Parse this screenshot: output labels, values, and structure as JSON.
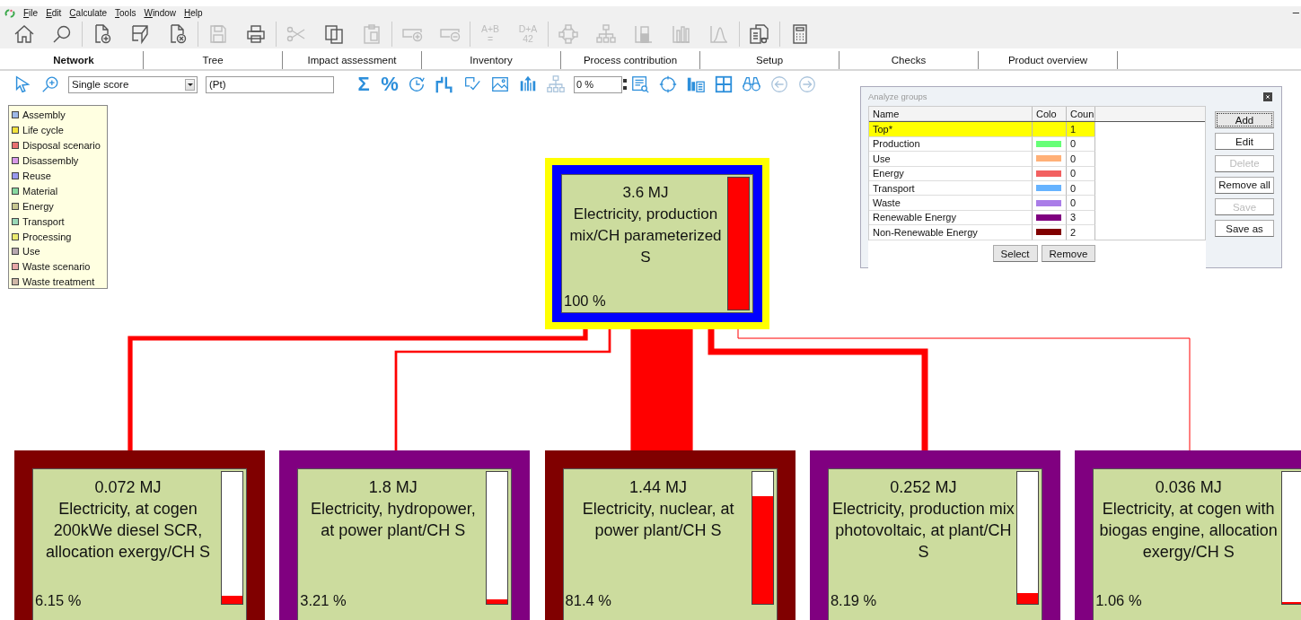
{
  "menu": {
    "items": [
      "File",
      "Edit",
      "Calculate",
      "Tools",
      "Window",
      "Help"
    ]
  },
  "minimize": "–",
  "toolbar": [
    [
      {
        "kind": "home",
        "disabled": false
      },
      {
        "kind": "search",
        "disabled": false
      }
    ],
    [
      {
        "kind": "new-doc",
        "disabled": false
      },
      {
        "kind": "open-doc",
        "disabled": false
      },
      {
        "kind": "close-doc",
        "disabled": false
      }
    ],
    [
      {
        "kind": "save",
        "disabled": true
      },
      {
        "kind": "print",
        "disabled": false
      }
    ],
    [
      {
        "kind": "cut",
        "disabled": true
      },
      {
        "kind": "copy",
        "disabled": false
      },
      {
        "kind": "paste",
        "disabled": true
      }
    ],
    [
      {
        "kind": "add-group",
        "disabled": true
      },
      {
        "kind": "remove-group",
        "disabled": true
      }
    ],
    [
      {
        "kind": "formula",
        "lines": [
          "A+B",
          "="
        ],
        "disabled": true
      },
      {
        "kind": "formula",
        "lines": [
          "D+A",
          "42"
        ],
        "disabled": true
      }
    ],
    [
      {
        "kind": "network",
        "disabled": true
      },
      {
        "kind": "tree",
        "disabled": true
      },
      {
        "kind": "bar",
        "disabled": true
      },
      {
        "kind": "bars",
        "disabled": true
      },
      {
        "kind": "curve",
        "disabled": true
      }
    ],
    [
      {
        "kind": "compare",
        "disabled": false
      }
    ],
    [
      {
        "kind": "calculator",
        "disabled": false
      }
    ]
  ],
  "tabs": [
    {
      "label": "Network",
      "selected": true
    },
    {
      "label": "Tree",
      "selected": false
    },
    {
      "label": "Impact assessment",
      "selected": false
    },
    {
      "label": "Inventory",
      "selected": false
    },
    {
      "label": "Process contribution",
      "selected": false
    },
    {
      "label": "Setup",
      "selected": false
    },
    {
      "label": "Checks",
      "selected": false
    },
    {
      "label": "Product overview",
      "selected": false
    }
  ],
  "view_toolbar": [
    {
      "kind": "pointer",
      "disabled": false
    },
    {
      "kind": "zoom-in",
      "disabled": false
    },
    {
      "kind": "select",
      "value": "Single score"
    },
    {
      "kind": "field",
      "value": "(Pt)"
    },
    {
      "kind": "symbol",
      "text": "Σ"
    },
    {
      "kind": "symbol",
      "text": "%"
    },
    {
      "kind": "clock",
      "disabled": false
    },
    {
      "kind": "cutoff",
      "disabled": false
    },
    {
      "kind": "check",
      "disabled": false
    },
    {
      "kind": "image",
      "disabled": false
    },
    {
      "kind": "bars-arrow",
      "disabled": false
    },
    {
      "kind": "tree",
      "disabled": true
    },
    {
      "kind": "spinner",
      "value": "0 %"
    },
    {
      "kind": "report",
      "disabled": false
    },
    {
      "kind": "crosshair",
      "disabled": false
    },
    {
      "kind": "legend-chart",
      "disabled": false
    },
    {
      "kind": "grid",
      "disabled": false
    },
    {
      "kind": "binoculars",
      "disabled": false
    },
    {
      "kind": "back",
      "disabled": true
    },
    {
      "kind": "forward",
      "disabled": true
    }
  ],
  "legend": [
    {
      "label": "Assembly",
      "color": "#9db8e8"
    },
    {
      "label": "Life cycle",
      "color": "#f2e23c"
    },
    {
      "label": "Disposal scenario",
      "color": "#e87070"
    },
    {
      "label": "Disassembly",
      "color": "#d89ae8"
    },
    {
      "label": "Reuse",
      "color": "#9a9aee"
    },
    {
      "label": "Material",
      "color": "#88d8a0"
    },
    {
      "label": "Energy",
      "color": "#c8c890"
    },
    {
      "label": "Transport",
      "color": "#9ad8b8"
    },
    {
      "label": "Processing",
      "color": "#ecec70"
    },
    {
      "label": "Use",
      "color": "#b8a8b0"
    },
    {
      "label": "Waste scenario",
      "color": "#e8a8a8"
    },
    {
      "label": "Waste treatment",
      "color": "#d0b8a8"
    }
  ],
  "network": {
    "top": {
      "amount": "3.6 MJ",
      "name": "Electricity, production mix/CH parameterized S",
      "percent": "100 %",
      "level": 1,
      "color": "#ffff00",
      "selected": true
    },
    "children": [
      {
        "amount": "0.072 MJ",
        "name": "Electricity, at cogen 200kWe diesel SCR, allocation exergy/CH S",
        "percent": "6.15 %",
        "level": 0.0615,
        "color": "#800000",
        "selected": false
      },
      {
        "amount": "1.8 MJ",
        "name": "Electricity, hydropower, at power plant/CH S",
        "percent": "3.21 %",
        "level": 0.0321,
        "color": "#800080",
        "selected": false
      },
      {
        "amount": "1.44 MJ",
        "name": "Electricity, nuclear, at power plant/CH S",
        "percent": "81.4 %",
        "level": 0.814,
        "color": "#800000",
        "selected": false
      },
      {
        "amount": "0.252 MJ",
        "name": "Electricity, production mix photovoltaic, at plant/CH S",
        "percent": "8.19 %",
        "level": 0.0819,
        "color": "#800080",
        "selected": false
      },
      {
        "amount": "0.036 MJ",
        "name": "Electricity, at cogen with biogas engine, allocation exergy/CH S",
        "percent": "1.06 %",
        "level": 0.0106,
        "color": "#800080",
        "selected": false
      }
    ]
  },
  "analyze_groups": {
    "title": "Analyze groups",
    "columns": [
      "Name",
      "Colo",
      "Coun"
    ],
    "rows": [
      {
        "name": "Top*",
        "count": "1",
        "selected": true
      },
      {
        "name": "Production",
        "color": "#66ff77",
        "count": "0",
        "selected": false
      },
      {
        "name": "Use",
        "color": "#ffb077",
        "count": "0",
        "selected": false
      },
      {
        "name": "Energy",
        "color": "#f26060",
        "count": "0",
        "selected": false
      },
      {
        "name": "Transport",
        "color": "#66b3ff",
        "count": "0",
        "selected": false
      },
      {
        "name": "Waste",
        "color": "#aa7de8",
        "count": "0",
        "selected": false
      },
      {
        "name": "Renewable Energy",
        "color": "#800080",
        "count": "3",
        "selected": false
      },
      {
        "name": "Non-Renewable Energy",
        "color": "#800000",
        "count": "2",
        "selected": false
      }
    ],
    "buttons": [
      {
        "label": "Add",
        "disabled": false,
        "focused": true
      },
      {
        "label": "Edit",
        "disabled": false,
        "focused": false
      },
      {
        "label": "Delete",
        "disabled": true,
        "focused": false
      },
      {
        "label": "Remove all",
        "disabled": false,
        "focused": false
      },
      {
        "label": "Save",
        "disabled": true,
        "focused": false
      },
      {
        "label": "Save as",
        "disabled": false,
        "focused": false
      }
    ],
    "bottom_buttons": [
      "Select",
      "Remove"
    ]
  }
}
